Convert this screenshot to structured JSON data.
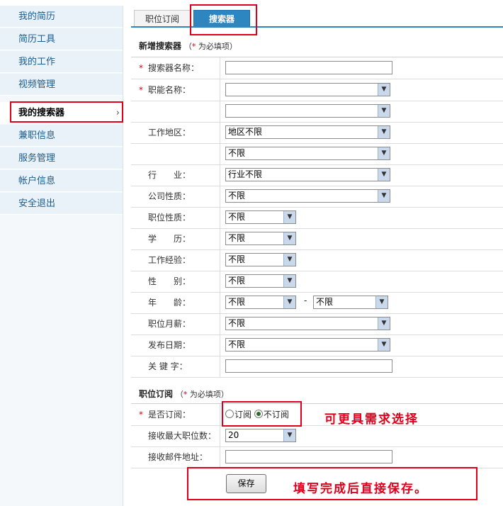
{
  "sidebar": {
    "items": [
      {
        "label": "我的简历"
      },
      {
        "label": "简历工具"
      },
      {
        "label": "我的工作"
      },
      {
        "label": "视频管理"
      },
      {
        "label": "我的搜索器",
        "chevron": "›"
      },
      {
        "label": "兼职信息"
      },
      {
        "label": "服务管理"
      },
      {
        "label": "帐户信息"
      },
      {
        "label": "安全退出"
      }
    ]
  },
  "tabs": [
    {
      "label": "职位订阅"
    },
    {
      "label": "搜索器"
    }
  ],
  "section1": {
    "title": "新增搜索器",
    "paren_open": "（",
    "star": "*",
    "note": " 为必填项）"
  },
  "section2": {
    "title": "职位订阅",
    "paren_open": "（",
    "star": "*",
    "note": " 为必填项）"
  },
  "form": {
    "searcher_name": {
      "label": "搜索器名称：",
      "value": ""
    },
    "function_name": {
      "label": "职能名称：",
      "value": "",
      "value2": ""
    },
    "work_area": {
      "label": "工作地区：",
      "value": "地区不限",
      "value2": "不限"
    },
    "industry": {
      "label": "行　　业：",
      "value": "行业不限"
    },
    "company_type": {
      "label": "公司性质：",
      "value": "不限"
    },
    "job_type": {
      "label": "职位性质：",
      "value": "不限"
    },
    "education": {
      "label": "学　　历：",
      "value": "不限"
    },
    "experience": {
      "label": "工作经验：",
      "value": "不限"
    },
    "gender": {
      "label": "性　　别：",
      "value": "不限"
    },
    "age": {
      "label": "年　　龄：",
      "from": "不限",
      "separator": "-",
      "to": "不限"
    },
    "salary": {
      "label": "职位月薪：",
      "value": "不限"
    },
    "publish_date": {
      "label": "发布日期：",
      "value": "不限"
    },
    "keyword": {
      "label": "关 键 字：",
      "value": ""
    }
  },
  "subscription": {
    "subscribe": {
      "label": "是否订阅：",
      "option_yes": "订阅",
      "option_no": "不订阅",
      "selected": "不订阅"
    },
    "max_jobs": {
      "label": "接收最大职位数：",
      "value": "20"
    },
    "email": {
      "label": "接收邮件地址：",
      "value": ""
    }
  },
  "annotations": {
    "choose_note": "可更具需求选择",
    "save_note": "填写完成后直接保存。"
  },
  "buttons": {
    "save": "保存"
  },
  "required_star": "*"
}
